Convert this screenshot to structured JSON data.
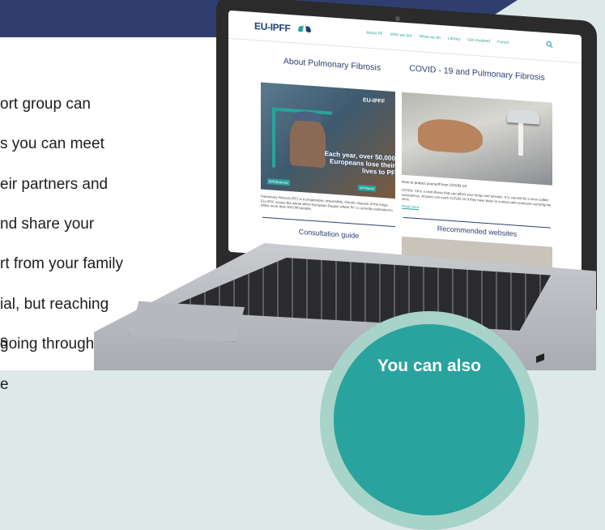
{
  "left_panel": {
    "lines": [
      "ort group can",
      "s you can meet",
      "eir partners and",
      "nd share your",
      "rt from your family",
      "ial, but reaching",
      " going through",
      "e"
    ],
    "stray_letter": "s"
  },
  "website": {
    "logo_text": "EU-IPFF",
    "nav_items": [
      "About PF",
      "Who we are",
      "What we do",
      "Library",
      "Get involved",
      "Forum"
    ],
    "col1_title": "About Pulmonary Fibrosis",
    "col2_title": "COVID - 19 and Pulmonary Fibrosis",
    "img1_caption": "Each year, over 50,000 Europeans lose their lives to PF",
    "img1_logo": "EU-IPFF",
    "img1_tag_left": "#PFdeserves",
    "img1_tag_right": "#PFWorld",
    "col1_text": "Pulmonary Fibrosis (PF) is a progressive, irreversible, chronic disease of the lungs. EU-IPFF covers the whole WHO European Region where PF is currently estimated to affect more than 300,000 people.",
    "col2_heading": "How to protect yourself from COVID-19",
    "col2_text": "COVID- 19 is a new illness that can affect your lungs and airways. It is caused by a virus called coronavirus. Anyone can catch COVID-19 if they have been in contact with someone carrying the virus.",
    "read_more": "Read more",
    "consultation": "Consultation guide",
    "recommended": "Recommended websites"
  },
  "callout": {
    "text": "You can also"
  },
  "colors": {
    "navy": "#2f3e6e",
    "teal": "#29a39d",
    "mint": "#a7d3c9",
    "background": "#dde9e8"
  }
}
